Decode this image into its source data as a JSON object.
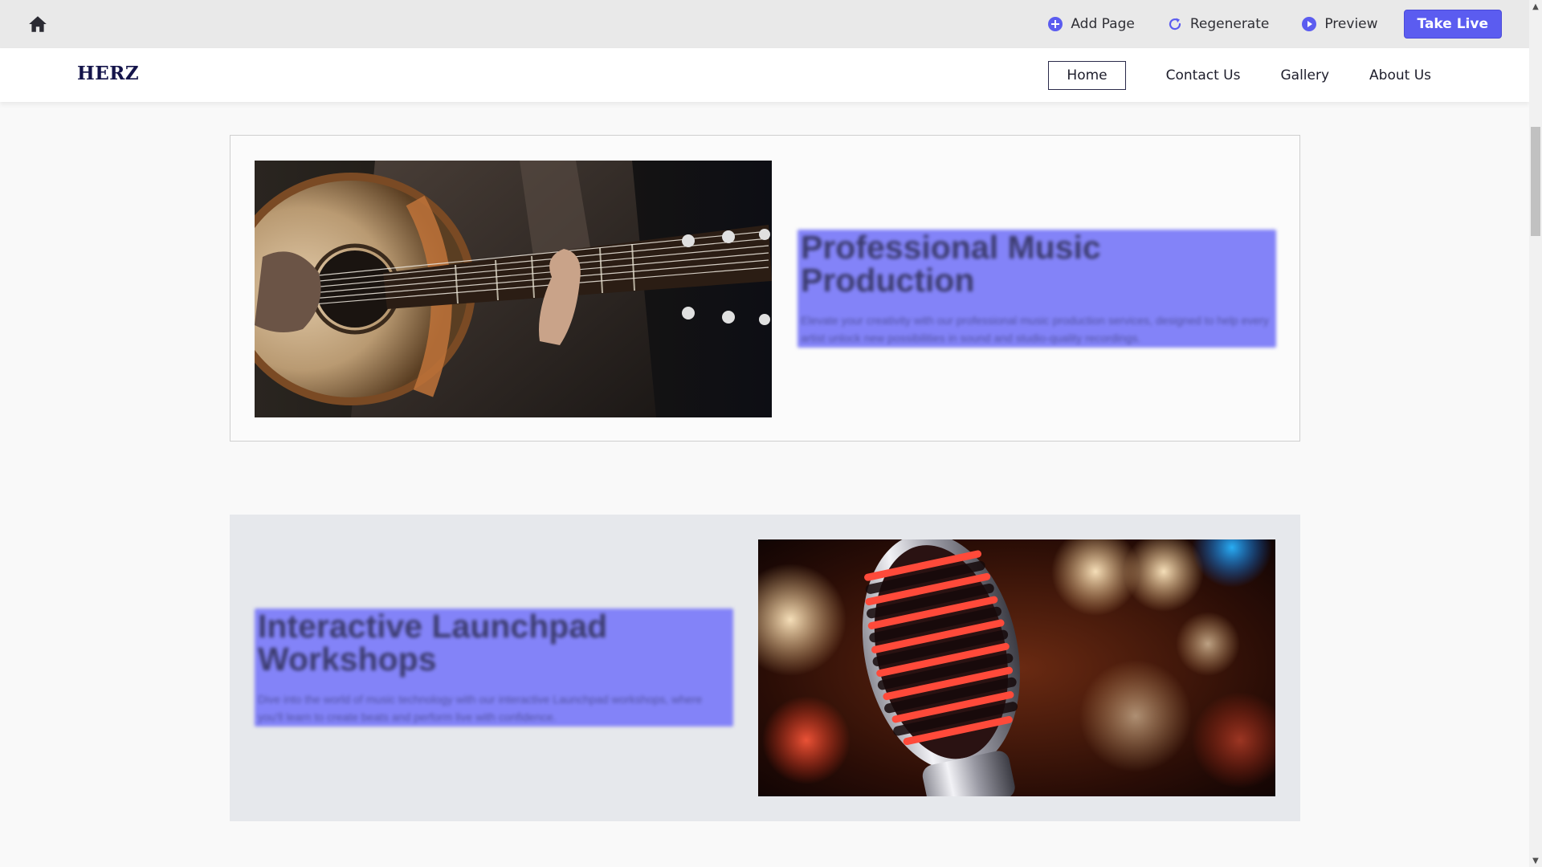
{
  "editor_toolbar": {
    "add_page_label": "Add Page",
    "regenerate_label": "Regenerate",
    "preview_label": "Preview",
    "take_live_label": "Take Live",
    "accent_color": "#5b5cf0"
  },
  "site": {
    "brand": "HERZ",
    "nav": {
      "home": "Home",
      "contact": "Contact Us",
      "gallery": "Gallery",
      "about": "About Us"
    }
  },
  "sections": [
    {
      "title": "Professional Music Production",
      "description": "Elevate your creativity with our professional music production services, designed to help every artist unlock new possibilities in sound and studio-quality recordings.",
      "image": "acoustic-guitar-photo"
    },
    {
      "title": "Interactive Launchpad Workshops",
      "description": "Dive into the world of music technology with our interactive Launchpad workshops, where you'll learn to create beats and perform live with confidence.",
      "image": "vintage-microphone-photo"
    }
  ],
  "icons": {
    "home": "home-icon",
    "add_page": "plus-circle-icon",
    "regenerate": "refresh-icon",
    "preview": "play-circle-icon"
  }
}
